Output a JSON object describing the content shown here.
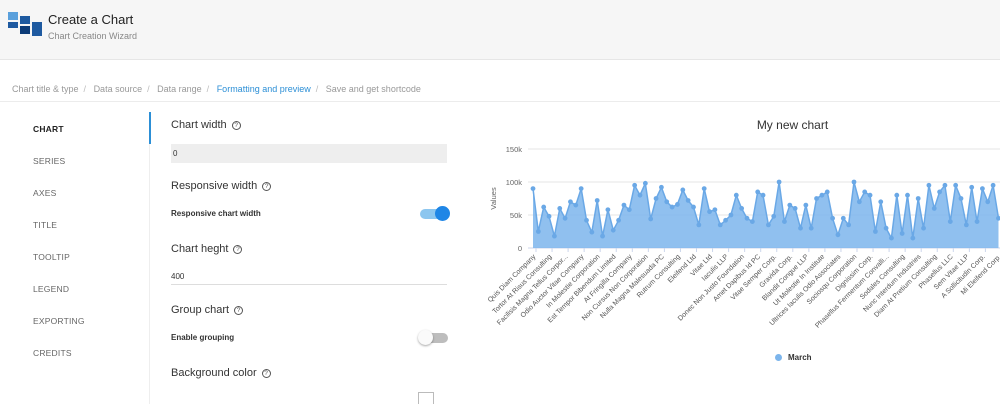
{
  "header": {
    "title": "Create a Chart",
    "subtitle": "Chart Creation Wizard",
    "logo_icon": "chart-wizard-logo",
    "logo_colors": [
      "#1e5aa0",
      "#5aa0dc",
      "#0d3c78"
    ]
  },
  "breadcrumb": [
    {
      "label": "Chart title & type",
      "active": false
    },
    {
      "label": "Data source",
      "active": false
    },
    {
      "label": "Data range",
      "active": false
    },
    {
      "label": "Formatting and preview",
      "active": true
    },
    {
      "label": "Save and get shortcode",
      "active": false
    }
  ],
  "sidebar": {
    "items": [
      {
        "label": "CHART",
        "active": true
      },
      {
        "label": "SERIES"
      },
      {
        "label": "AXES"
      },
      {
        "label": "TITLE"
      },
      {
        "label": "TOOLTIP"
      },
      {
        "label": "LEGEND"
      },
      {
        "label": "EXPORTING"
      },
      {
        "label": "CREDITS"
      }
    ]
  },
  "form": {
    "chart_width": {
      "label": "Chart width",
      "value": "0"
    },
    "responsive_width": {
      "label": "Responsive width",
      "toggle_label": "Responsive chart width",
      "enabled": true
    },
    "chart_height": {
      "label": "Chart heght",
      "value": "400"
    },
    "group_chart": {
      "label": "Group chart",
      "toggle_label": "Enable grouping",
      "enabled": false
    },
    "background_color": {
      "label": "Background color",
      "value": "#ffffff"
    },
    "help_icon": "?"
  },
  "colors": {
    "accent": "#2c8fd6",
    "series": "#7cb5ec",
    "series_line": "#6aa8e6"
  },
  "chart_data": {
    "type": "area",
    "title": "My new chart",
    "ylabel": "Values",
    "ylim": [
      0,
      150000
    ],
    "yticks": [
      "0",
      "50k",
      "100k",
      "150k"
    ],
    "legend_position": "bottom-center",
    "series": [
      {
        "name": "March",
        "values": [
          90000,
          25000,
          62000,
          48000,
          18000,
          60000,
          45000,
          70000,
          65000,
          90000,
          42000,
          24000,
          72000,
          18000,
          58000,
          27000,
          42000,
          65000,
          58000,
          95000,
          80000,
          98000,
          44000,
          75000,
          92000,
          70000,
          62000,
          66000,
          88000,
          72000,
          62000,
          35000,
          90000,
          55000,
          58000,
          35000,
          42000,
          50000,
          80000,
          60000,
          45000,
          40000,
          85000,
          80000,
          35000,
          48000,
          100000,
          40000,
          65000,
          60000,
          30000,
          65000,
          30000,
          75000,
          80000,
          85000,
          45000,
          20000,
          45000,
          35000,
          100000,
          70000,
          85000,
          80000,
          25000,
          70000,
          30000,
          15000,
          80000,
          22000,
          80000,
          15000,
          75000,
          30000,
          95000,
          60000,
          85000,
          95000,
          40000,
          95000,
          75000,
          35000,
          92000,
          40000,
          90000,
          70000,
          95000,
          45000
        ]
      }
    ],
    "categories": [
      "Quis Diam Company",
      "Tortor At Risus Consulting",
      "Facilisis Magna Tellus Corpor...",
      "Odio Auctor Vitae Company",
      "In Molestie Corporation",
      "Est Tempor Bibendum Limited",
      "At Fringilla Company",
      "Non Cursus Non Corporation",
      "Nulla Magna Malesuada PC",
      "Rutrum Consulting",
      "Eleifend Ltd",
      "Vitae Ltd",
      "Iaculis LLP",
      "Donec Non Justo Foundation",
      "Amet Dapibus Id PC",
      "Vitae Semper Corp.",
      "Gravida Corp.",
      "Blandit Congue LLP",
      "Ut Molestie In Institute",
      "Ultrices Iaculis Odio Associates",
      "Sociosqu Corporation",
      "Dignissim Corp.",
      "Phasellus Fermentum Convalli...",
      "Sodales Consulting",
      "Nunc Interdum Industries",
      "Diam At Pretium Consulting",
      "Phasellus LLC",
      "Sem Vitae LLP",
      "A Sollicitudin Corp.",
      "Mi Eleifend Corp."
    ]
  }
}
